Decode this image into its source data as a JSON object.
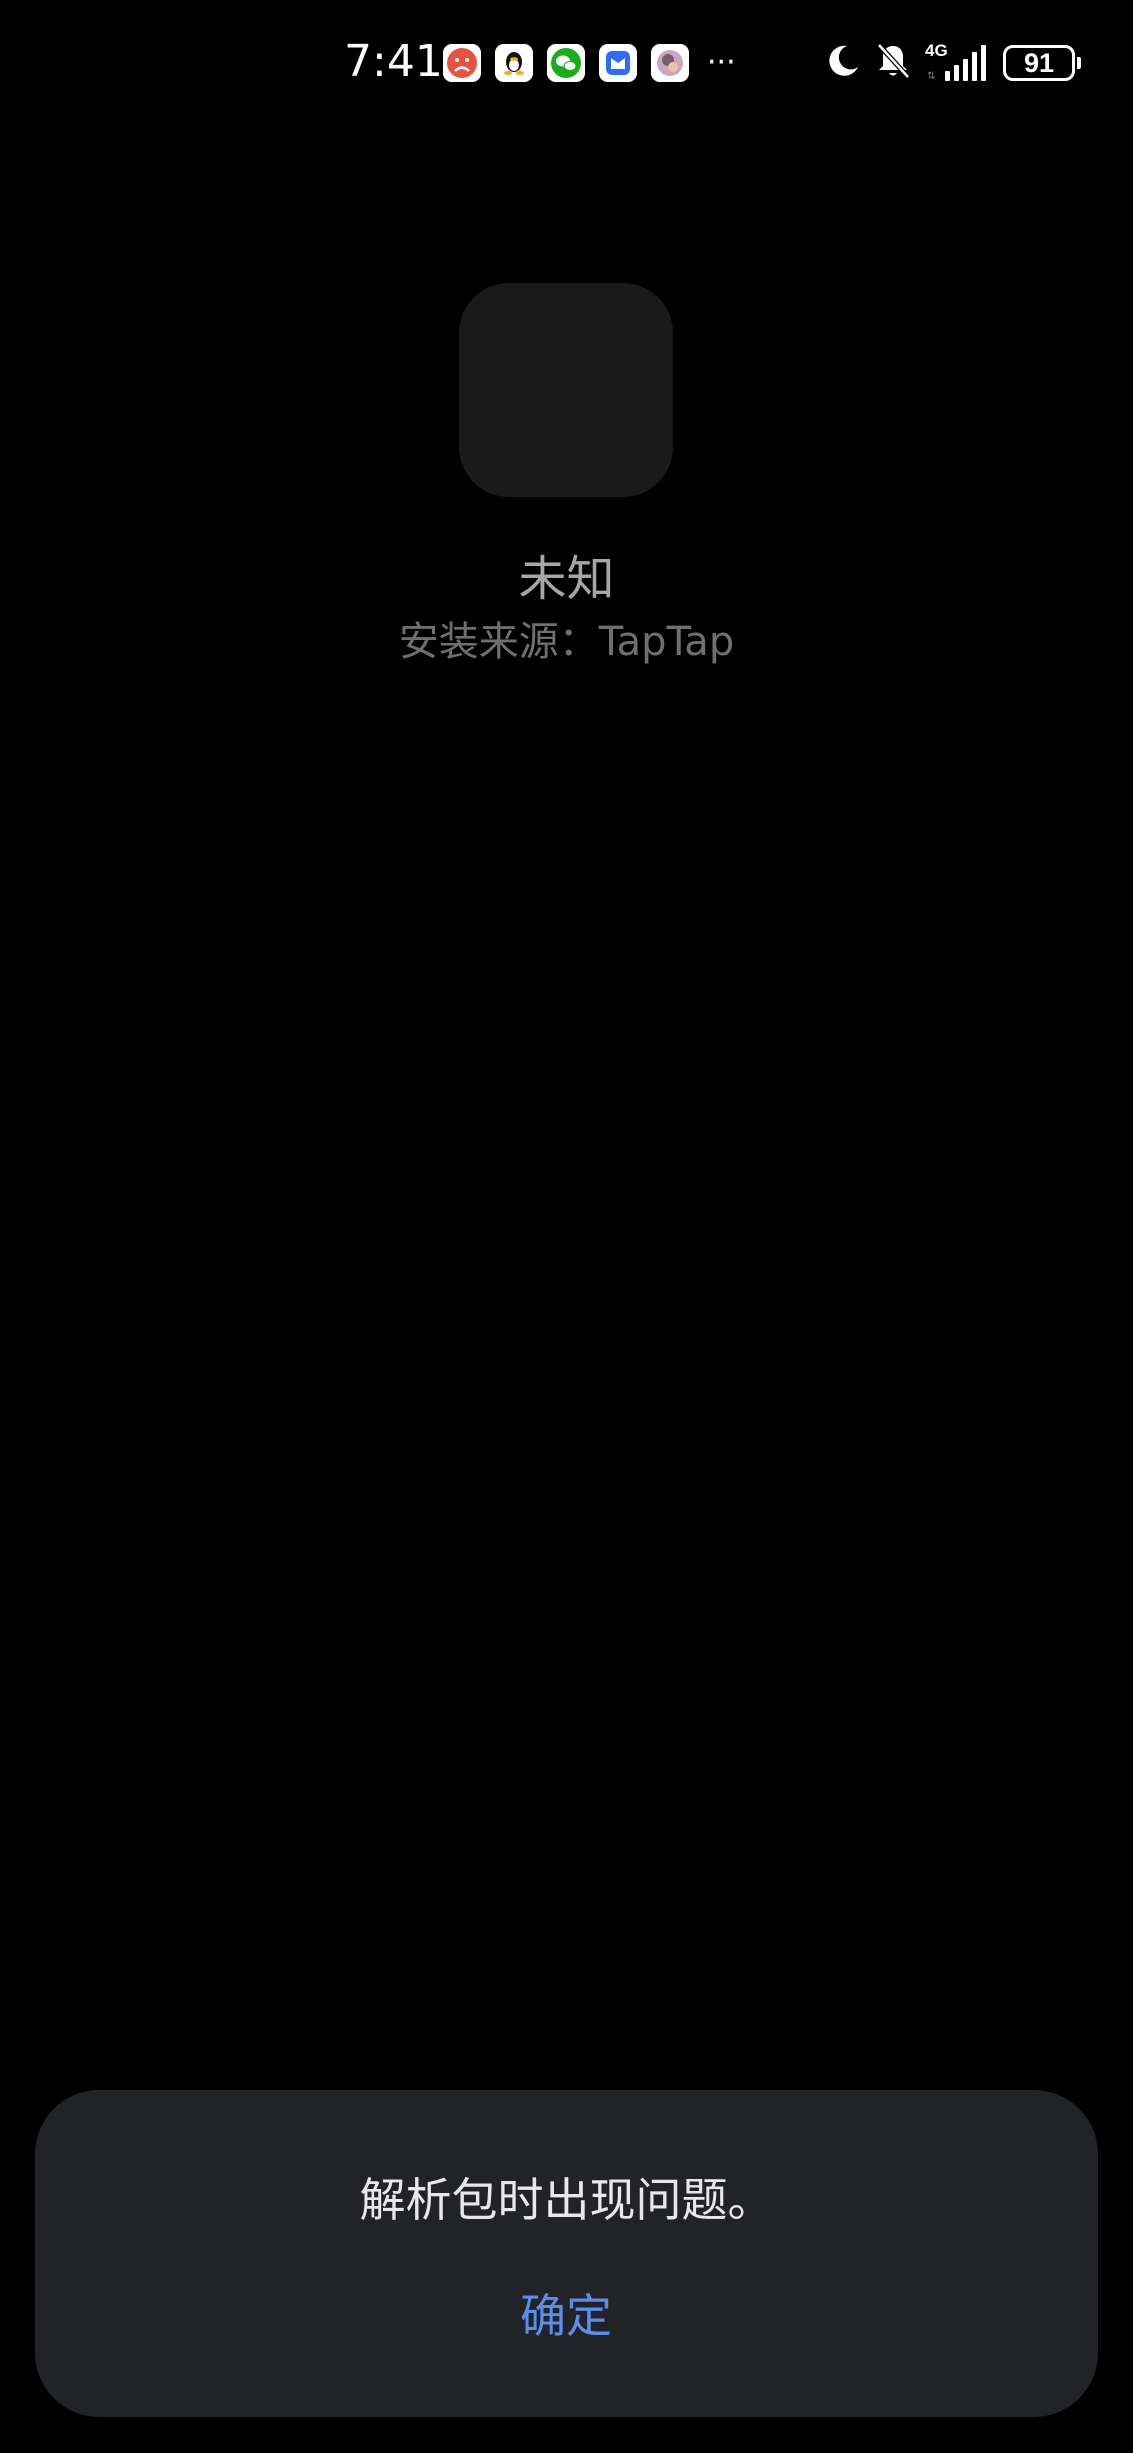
{
  "status_bar": {
    "time": "7:41",
    "notification_icons": [
      "app-red-face-icon",
      "qq-icon",
      "wechat-icon",
      "blue-mail-icon",
      "avatar-app-icon"
    ],
    "more_indicator": "···",
    "network_label": "4G",
    "battery_level": "91",
    "icons": [
      "moon-icon",
      "bell-muted-icon",
      "signal-icon",
      "battery-icon"
    ]
  },
  "app": {
    "name": "未知",
    "install_source": "安装来源：TapTap"
  },
  "dialog": {
    "message": "解析包时出现问题。",
    "confirm_label": "确定"
  },
  "colors": {
    "background": "#000000",
    "dialog_background": "#222326",
    "accent": "#5b8def",
    "icon_placeholder": "#1a1a1a"
  }
}
